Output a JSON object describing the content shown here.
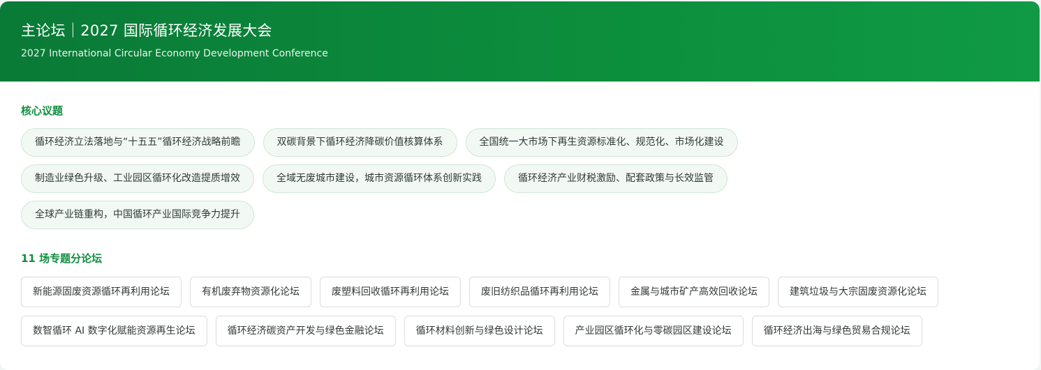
{
  "header": {
    "title": "主论坛｜2027 国际循环经济发展大会",
    "subtitle": "2027 International Circular Economy Development Conference"
  },
  "topics": {
    "heading": "核心议题",
    "items": [
      "循环经济立法落地与“十五五”循环经济战略前瞻",
      "双碳背景下循环经济降碳价值核算体系",
      "全国统一大市场下再生资源标准化、规范化、市场化建设",
      "制造业绿色升级、工业园区循环化改造提质增效",
      "全域无废城市建设，城市资源循环体系创新实践",
      "循环经济产业财税激励、配套政策与长效监管",
      "全球产业链重构，中国循环产业国际竞争力提升"
    ]
  },
  "forums": {
    "heading": "11 场专题分论坛",
    "items": [
      "新能源固废资源循环再利用论坛",
      "有机废弃物资源化论坛",
      "废塑料回收循环再利用论坛",
      "废旧纺织品循环再利用论坛",
      "金属与城市矿产高效回收论坛",
      "建筑垃圾与大宗固废资源化论坛",
      "数智循环 AI 数字化赋能资源再生论坛",
      "循环经济碳资产开发与绿色金融论坛",
      "循环材料创新与绿色设计论坛",
      "产业园区循环化与零碳园区建设论坛",
      "循环经济出海与绿色贸易合规论坛"
    ]
  },
  "colors": {
    "brand_green": "#0c8f3d",
    "pill_bg": "#f2f9f4",
    "pill_border": "#cfe6d6"
  }
}
